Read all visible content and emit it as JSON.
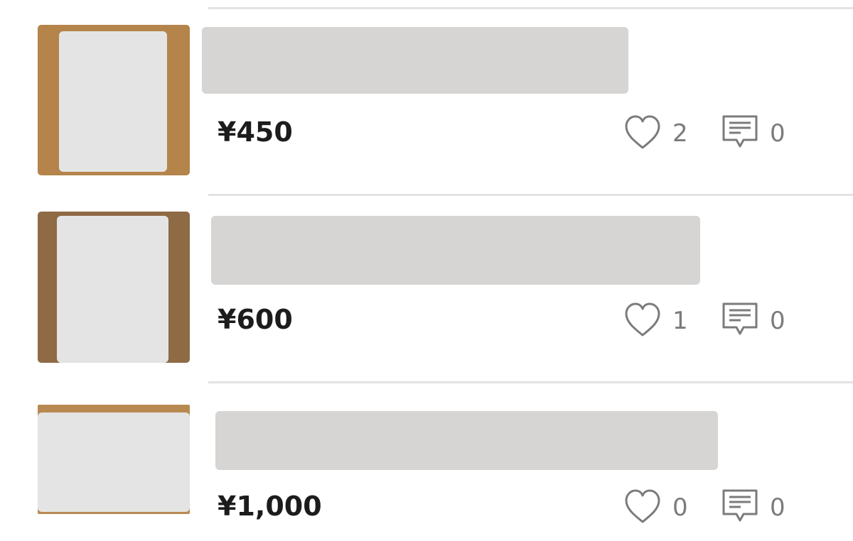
{
  "colors": {
    "thumb_backgrounds": [
      "#b4844a",
      "#8e6a45",
      "#b88a52"
    ],
    "placeholder": "#d6d5d4",
    "price_text": "#1c1c1c",
    "meta_text": "#7b7b7b"
  },
  "listings": [
    {
      "price": "¥450",
      "likes": "2",
      "comments": "0",
      "like_icon": "heart-outline-icon",
      "comment_icon": "speech-bubble-icon"
    },
    {
      "price": "¥600",
      "likes": "1",
      "comments": "0",
      "like_icon": "heart-outline-icon",
      "comment_icon": "speech-bubble-icon"
    },
    {
      "price": "¥1,000",
      "likes": "0",
      "comments": "0",
      "like_icon": "heart-outline-icon",
      "comment_icon": "speech-bubble-icon"
    }
  ]
}
